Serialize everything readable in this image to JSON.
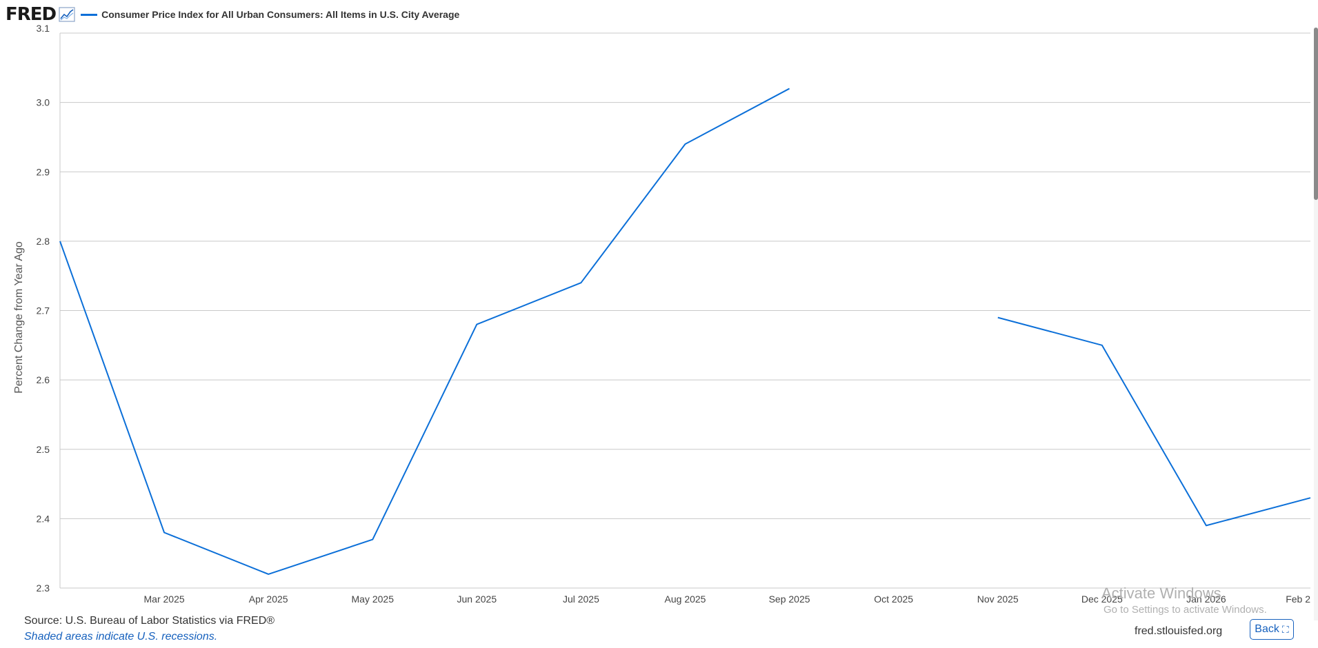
{
  "header": {
    "logo": "FRED",
    "logo_icon": "line-chart-icon"
  },
  "colors": {
    "series": "#0b6fd8",
    "grid": "#c8c8c8",
    "link": "#1560bd"
  },
  "chart_data": {
    "type": "line",
    "title": "",
    "ylabel": "Percent Change from Year Ago",
    "xlabel": "",
    "ylim": [
      2.3,
      3.1
    ],
    "yticks": [
      "2.3",
      "2.4",
      "2.5",
      "2.6",
      "2.7",
      "2.8",
      "2.9",
      "3.0",
      "3.1"
    ],
    "xlim": [
      "2025-02",
      "2026-02"
    ],
    "xticks": [
      "Mar 2025",
      "Apr 2025",
      "May 2025",
      "Jun 2025",
      "Jul 2025",
      "Aug 2025",
      "Sep 2025",
      "Oct 2025",
      "Nov 2025",
      "Dec 2025",
      "Jan 2026",
      "Feb 2"
    ],
    "legend": "top-left",
    "grid": true,
    "series": [
      {
        "name": "Consumer Price Index for All Urban Consumers: All Items in U.S. City Average",
        "x": [
          "2025-02",
          "2025-03",
          "2025-04",
          "2025-05",
          "2025-06",
          "2025-07",
          "2025-08",
          "2025-09",
          "2025-10",
          "2025-11",
          "2025-12",
          "2026-01",
          "2026-02"
        ],
        "y": [
          2.8,
          2.38,
          2.32,
          2.37,
          2.68,
          2.74,
          2.94,
          3.02,
          null,
          2.69,
          2.65,
          2.39,
          2.43
        ]
      }
    ]
  },
  "footer": {
    "source": "Source: U.S. Bureau of Labor Statistics via FRED®",
    "shaded_note": "Shaded areas indicate U.S. recessions.",
    "site": "fred.stlouisfed.org",
    "back_label": "Back",
    "back_icon": "collapse-icon"
  },
  "watermark": {
    "line1": "Activate Windows",
    "line2": "Go to Settings to activate Windows."
  }
}
